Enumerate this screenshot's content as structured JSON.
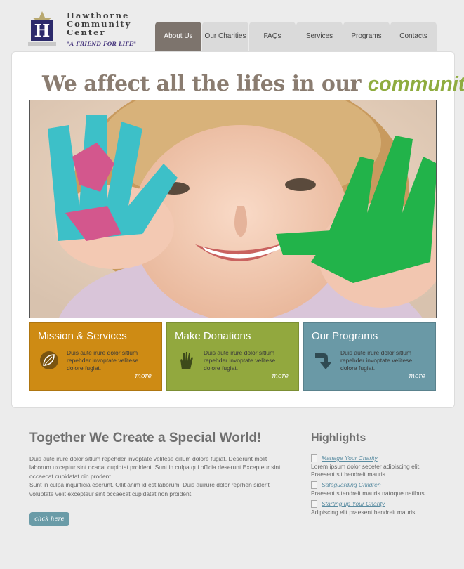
{
  "logo": {
    "line1": "Hawthorne",
    "line2": "Community",
    "line3": "Center",
    "tagline": "\"A FRIEND FOR LIFE\"",
    "mark_letter": "H"
  },
  "nav": {
    "tabs": [
      {
        "label": "About Us",
        "active": true
      },
      {
        "label": "Our Charities"
      },
      {
        "label": "FAQs"
      },
      {
        "label": "Services"
      },
      {
        "label": "Programs"
      },
      {
        "label": "Contacts"
      }
    ]
  },
  "hero": {
    "headline": "We affect all the lifes in our",
    "headline_accent": "community"
  },
  "features": [
    {
      "title": "Mission & Services",
      "text": "Duis aute irure dolor sitlum repehder invoptate velitese dolore fugiat.",
      "more": "more",
      "icon": "leaf-icon",
      "color": "#ce8b14"
    },
    {
      "title": "Make Donations",
      "text": "Duis aute irure dolor sitlum repehder invoptate velitese dolore fugiat.",
      "more": "more",
      "icon": "hand-icon",
      "color": "#92a83e"
    },
    {
      "title": "Our Programs",
      "text": "Duis aute irure dolor sitlum repehder invoptate velitese dolore fugiat.",
      "more": "more",
      "icon": "arrow-down-icon",
      "color": "#6a99a6"
    }
  ],
  "main": {
    "title": "Together We Create a Special World!",
    "para1": "Duis aute irure dolor sitlum repehder invoptate velitese cillum dolore fugiat. Deserunt molit laborum uxceptur sint ocacat cupidtat proident. Sunt in culpa qui officia deserunt.Excepteur sint occaecat cupidatat oin prodent.",
    "para2": "Sunt in culpa inquifficia eserunt. Ollit anim id est laborum. Duis auirure dolor reprhen siderit voluptate velit excepteur sint occaecat cupidatat non proident.",
    "button_label": "click here"
  },
  "highlights": {
    "title": "Highlights",
    "items": [
      {
        "link": "Manage Your Charity",
        "desc": "Lorem ipsum dolor seceter adipiscing elit. Praesent sit hendreit mauris."
      },
      {
        "link": "Safeguarding Children",
        "desc": "Praesent sitendreit mauris natoque natibus"
      },
      {
        "link": "Starting up Your Charity",
        "desc": "Adipiscing elit praesent hendreit mauris."
      }
    ]
  }
}
